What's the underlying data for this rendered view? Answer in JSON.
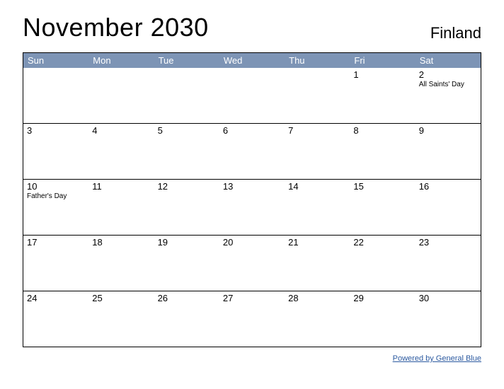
{
  "title": "November 2030",
  "country": "Finland",
  "daysOfWeek": [
    "Sun",
    "Mon",
    "Tue",
    "Wed",
    "Thu",
    "Fri",
    "Sat"
  ],
  "weeks": [
    [
      {
        "num": "",
        "event": ""
      },
      {
        "num": "",
        "event": ""
      },
      {
        "num": "",
        "event": ""
      },
      {
        "num": "",
        "event": ""
      },
      {
        "num": "",
        "event": ""
      },
      {
        "num": "1",
        "event": ""
      },
      {
        "num": "2",
        "event": "All Saints' Day"
      }
    ],
    [
      {
        "num": "3",
        "event": ""
      },
      {
        "num": "4",
        "event": ""
      },
      {
        "num": "5",
        "event": ""
      },
      {
        "num": "6",
        "event": ""
      },
      {
        "num": "7",
        "event": ""
      },
      {
        "num": "8",
        "event": ""
      },
      {
        "num": "9",
        "event": ""
      }
    ],
    [
      {
        "num": "10",
        "event": "Father's Day"
      },
      {
        "num": "11",
        "event": ""
      },
      {
        "num": "12",
        "event": ""
      },
      {
        "num": "13",
        "event": ""
      },
      {
        "num": "14",
        "event": ""
      },
      {
        "num": "15",
        "event": ""
      },
      {
        "num": "16",
        "event": ""
      }
    ],
    [
      {
        "num": "17",
        "event": ""
      },
      {
        "num": "18",
        "event": ""
      },
      {
        "num": "19",
        "event": ""
      },
      {
        "num": "20",
        "event": ""
      },
      {
        "num": "21",
        "event": ""
      },
      {
        "num": "22",
        "event": ""
      },
      {
        "num": "23",
        "event": ""
      }
    ],
    [
      {
        "num": "24",
        "event": ""
      },
      {
        "num": "25",
        "event": ""
      },
      {
        "num": "26",
        "event": ""
      },
      {
        "num": "27",
        "event": ""
      },
      {
        "num": "28",
        "event": ""
      },
      {
        "num": "29",
        "event": ""
      },
      {
        "num": "30",
        "event": ""
      }
    ]
  ],
  "footerLink": "Powered by General Blue"
}
